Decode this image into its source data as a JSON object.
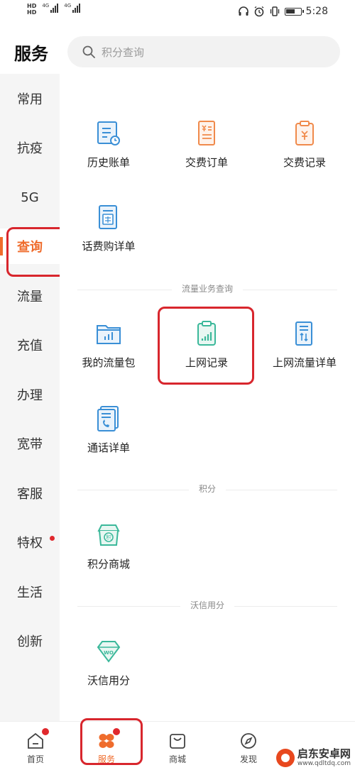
{
  "status_bar": {
    "time": "5:28",
    "network1": "4G",
    "network2": "4G",
    "hd": "HD"
  },
  "header": {
    "title": "服务",
    "search_placeholder": "积分查询"
  },
  "sidebar": {
    "items": [
      {
        "label": "常用"
      },
      {
        "label": "抗疫"
      },
      {
        "label": "5G"
      },
      {
        "label": "查询"
      },
      {
        "label": "流量"
      },
      {
        "label": "充值"
      },
      {
        "label": "办理"
      },
      {
        "label": "宽带"
      },
      {
        "label": "客服"
      },
      {
        "label": "特权"
      },
      {
        "label": "生活"
      },
      {
        "label": "创新"
      }
    ],
    "active": "查询"
  },
  "sections": {
    "billing": {
      "items": [
        {
          "label": "历史账单",
          "icon": "bill-history-icon"
        },
        {
          "label": "交费订单",
          "icon": "payment-order-icon"
        },
        {
          "label": "交费记录",
          "icon": "payment-record-icon"
        },
        {
          "label": "话费购详单",
          "icon": "phone-purchase-detail-icon"
        }
      ]
    },
    "traffic": {
      "title": "流量业务查询",
      "items": [
        {
          "label": "我的流量包",
          "icon": "data-package-icon"
        },
        {
          "label": "上网记录",
          "icon": "internet-record-icon"
        },
        {
          "label": "上网流量详单",
          "icon": "data-detail-icon"
        },
        {
          "label": "通话详单",
          "icon": "call-detail-icon"
        }
      ]
    },
    "points": {
      "title": "积分",
      "items": [
        {
          "label": "积分商城",
          "icon": "points-mall-icon"
        }
      ]
    },
    "wo": {
      "title": "沃信用分",
      "items": [
        {
          "label": "沃信用分",
          "icon": "wo-credit-icon"
        }
      ]
    }
  },
  "tabbar": {
    "items": [
      {
        "label": "首页",
        "icon": "home-icon"
      },
      {
        "label": "服务",
        "icon": "service-icon"
      },
      {
        "label": "商城",
        "icon": "shop-bag-icon"
      },
      {
        "label": "发现",
        "icon": "compass-icon"
      }
    ],
    "active": "服务"
  },
  "watermark": {
    "name": "启东安卓网",
    "url": "www.qdltdq.com"
  },
  "colors": {
    "accent": "#ef6c2c",
    "highlight": "#d8262d",
    "icon_blue": "#3a8fd6",
    "icon_orange": "#f08a4b",
    "icon_green": "#3bb89a"
  }
}
